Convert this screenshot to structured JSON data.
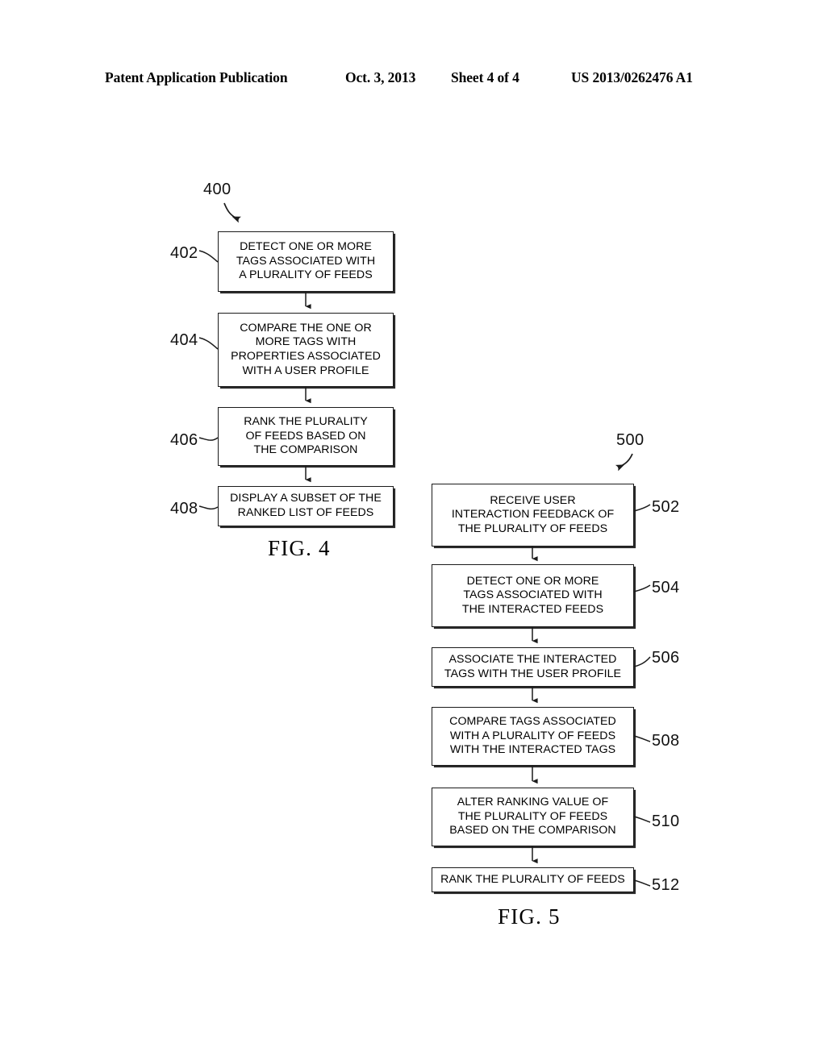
{
  "header": {
    "publication": "Patent Application Publication",
    "date": "Oct. 3, 2013",
    "sheet": "Sheet 4 of 4",
    "document_number": "US 2013/0262476 A1"
  },
  "figures": [
    {
      "id": "fig4",
      "caption": "FIG. 4",
      "diagram_label": "400",
      "steps": [
        {
          "ref": "402",
          "text": "DETECT ONE OR MORE\nTAGS ASSOCIATED WITH\nA PLURALITY OF FEEDS"
        },
        {
          "ref": "404",
          "text": "COMPARE THE ONE OR\nMORE TAGS WITH\nPROPERTIES ASSOCIATED\nWITH A USER PROFILE"
        },
        {
          "ref": "406",
          "text": "RANK THE PLURALITY\nOF FEEDS BASED ON\nTHE COMPARISON"
        },
        {
          "ref": "408",
          "text": "DISPLAY A SUBSET OF THE\nRANKED LIST OF FEEDS"
        }
      ]
    },
    {
      "id": "fig5",
      "caption": "FIG. 5",
      "diagram_label": "500",
      "steps": [
        {
          "ref": "502",
          "text": "RECEIVE USER\nINTERACTION FEEDBACK OF\nTHE PLURALITY OF FEEDS"
        },
        {
          "ref": "504",
          "text": "DETECT ONE OR MORE\nTAGS ASSOCIATED WITH\nTHE INTERACTED FEEDS"
        },
        {
          "ref": "506",
          "text": "ASSOCIATE THE INTERACTED\nTAGS WITH THE USER PROFILE"
        },
        {
          "ref": "508",
          "text": "COMPARE TAGS ASSOCIATED\nWITH A PLURALITY OF FEEDS\nWITH THE INTERACTED TAGS"
        },
        {
          "ref": "510",
          "text": "ALTER RANKING VALUE OF\nTHE PLURALITY OF FEEDS\nBASED ON THE COMPARISON"
        },
        {
          "ref": "512",
          "text": "RANK THE PLURALITY OF FEEDS"
        }
      ]
    }
  ],
  "colors": {
    "ink": "#000000",
    "box_border": "#1b1b1b",
    "paper": "#ffffff"
  }
}
